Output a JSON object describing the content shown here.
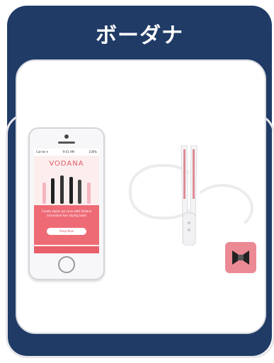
{
  "header": {
    "title": "ボーダナ"
  },
  "phone_screen": {
    "status_left": "Carrier ▾",
    "status_center": "9:41 AM",
    "status_right": "100%",
    "brand": "VODANA",
    "promo_text": "Create styles you love with Vodana innovative hair styling tools",
    "cta_label": "Shop Now"
  },
  "colors": {
    "header_bg": "#1f3b66",
    "accent_pink": "#ee6b76",
    "badge_pink": "#eb8a94"
  },
  "icons": [
    "phone-device",
    "hair-straightener",
    "product-badge"
  ]
}
